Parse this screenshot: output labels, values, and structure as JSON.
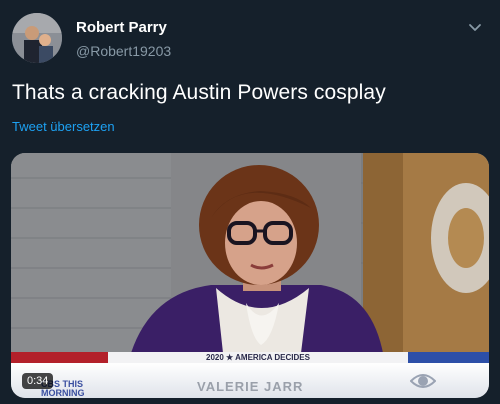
{
  "author": {
    "display_name": "Robert Parry",
    "handle": "@Robert19203"
  },
  "tweet": {
    "text": "Thats a cracking Austin Powers cosplay",
    "translate_link": "Tweet übersetzen"
  },
  "video": {
    "duration": "0:34",
    "banner_text": "2020 ★ AMERICA DECIDES",
    "nameplate_text": "VALERIE JARR",
    "show_logo_line1": "CBS THIS",
    "show_logo_line2": "MORNING"
  },
  "colors": {
    "background": "#15202b",
    "accent": "#1da1f2",
    "secondary_text": "#8899a6"
  },
  "icons": {
    "menu": "chevron-down-icon",
    "network": "cbs-eye-icon"
  }
}
